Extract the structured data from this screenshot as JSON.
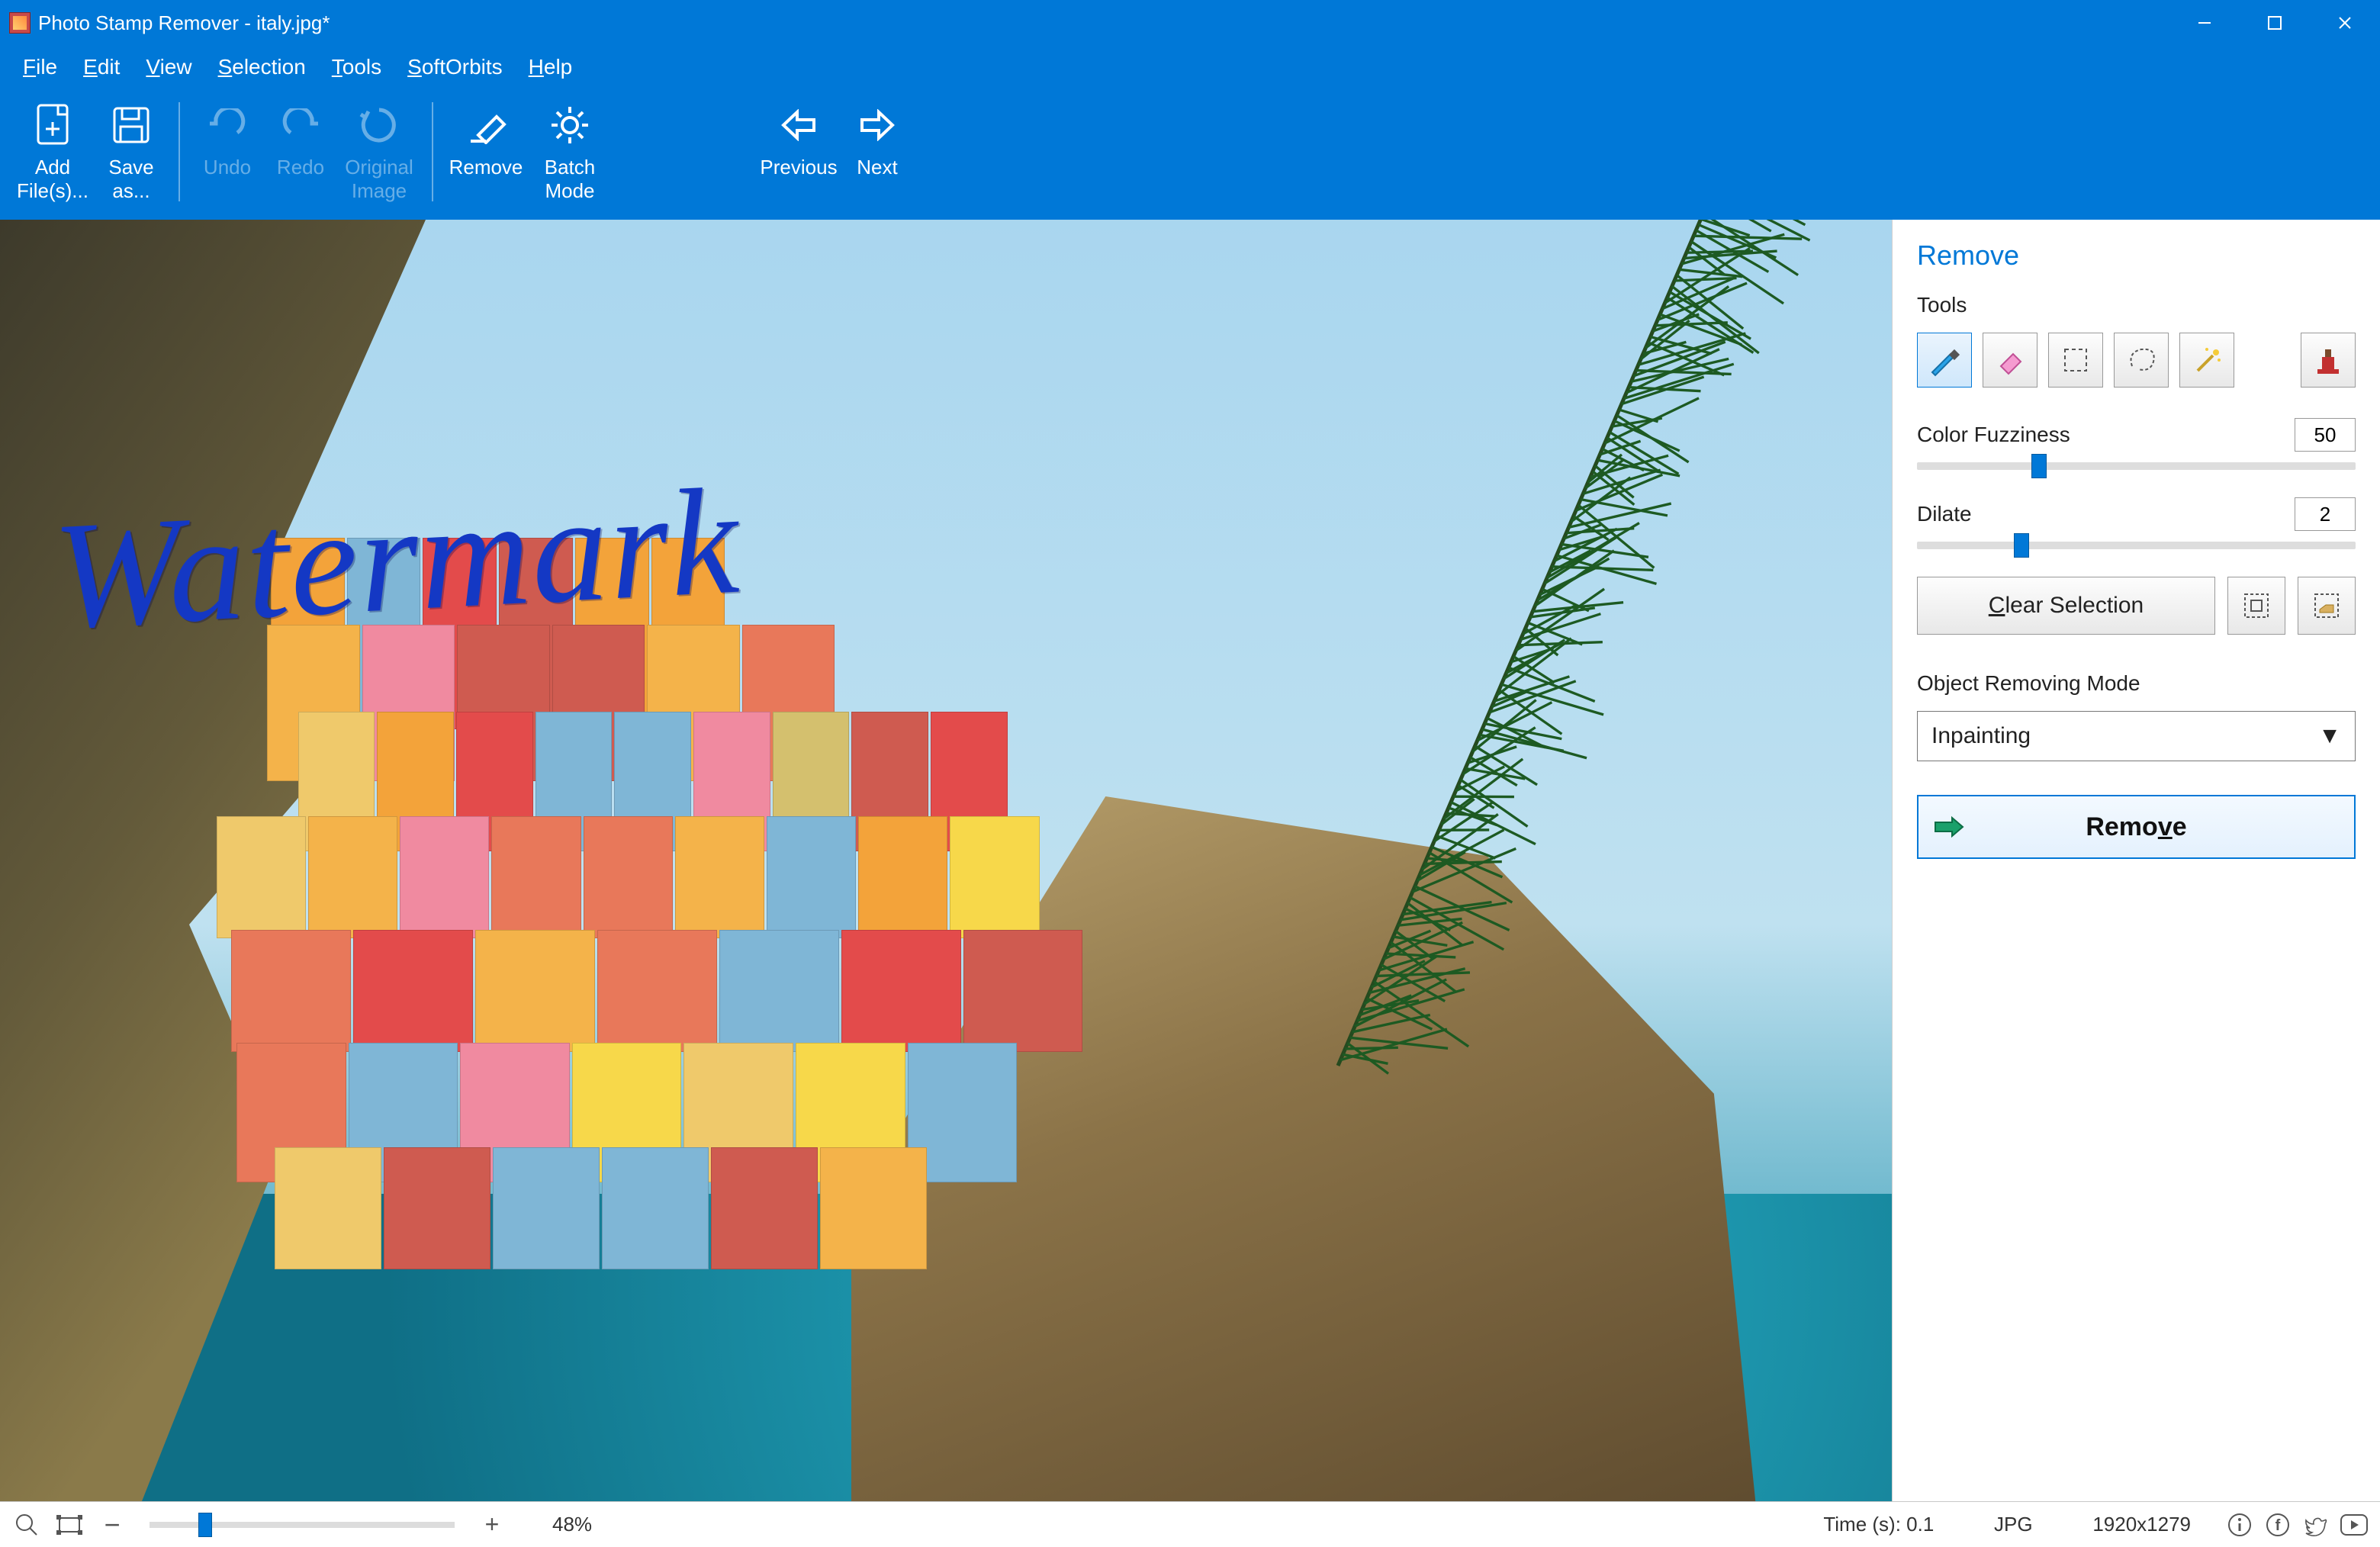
{
  "title": "Photo Stamp Remover - italy.jpg*",
  "menu": [
    "File",
    "Edit",
    "View",
    "Selection",
    "Tools",
    "SoftOrbits",
    "Help"
  ],
  "toolbar": {
    "add": "Add File(s)...",
    "save": "Save as...",
    "undo": "Undo",
    "redo": "Redo",
    "original": "Original Image",
    "remove": "Remove",
    "batch": "Batch Mode",
    "previous": "Previous",
    "next": "Next"
  },
  "canvas": {
    "watermark_text": "Watermark"
  },
  "panel": {
    "title": "Remove",
    "tools_label": "Tools",
    "color_fuzziness_label": "Color Fuzziness",
    "color_fuzziness_value": "50",
    "color_fuzziness_pct": 26,
    "dilate_label": "Dilate",
    "dilate_value": "2",
    "dilate_pct": 22,
    "clear_selection": "Clear Selection",
    "mode_label": "Object Removing Mode",
    "mode_value": "Inpainting",
    "remove_button": "Remove"
  },
  "status": {
    "zoom_pct_label": "48%",
    "zoom_slider_pct": 16,
    "time_label": "Time (s): 0.1",
    "format": "JPG",
    "dimensions": "1920x1279"
  }
}
